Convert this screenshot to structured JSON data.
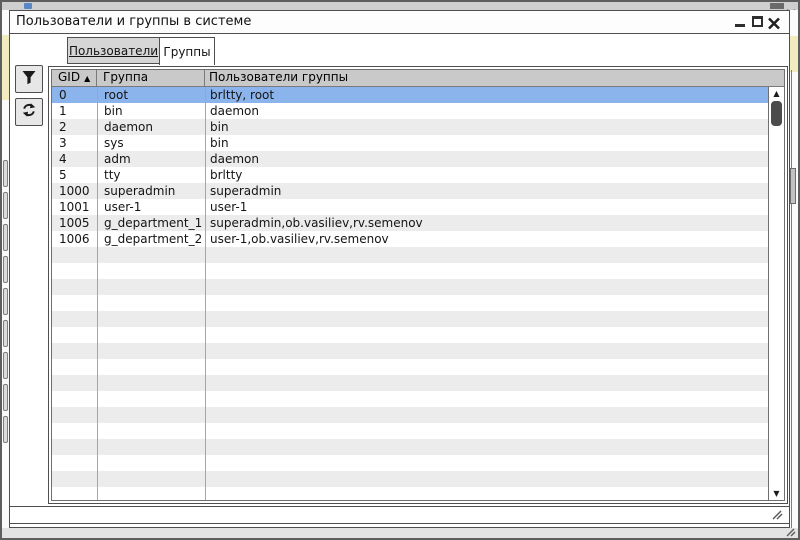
{
  "outer_window": {
    "close_icon": "close-icon"
  },
  "window": {
    "title": "Пользователи и группы в системе",
    "controls": {
      "minimize": "minimize-icon",
      "maximize": "maximize-icon",
      "close": "close-icon"
    }
  },
  "tabs": [
    {
      "label": "Пользователи",
      "active": false
    },
    {
      "label": "Группы",
      "active": true
    }
  ],
  "toolbar": {
    "filter_icon": "filter-funnel-icon",
    "refresh_icon": "refresh-icon"
  },
  "table": {
    "columns": [
      {
        "label": "GID"
      },
      {
        "label": "Группа"
      },
      {
        "label": "Пользователи группы"
      }
    ],
    "sorted_by": "GID",
    "sort_order": "asc",
    "sort_indicator": "▲",
    "rows": [
      {
        "gid": "0",
        "group": "root",
        "users": "brltty, root",
        "selected": true
      },
      {
        "gid": "1",
        "group": "bin",
        "users": "daemon"
      },
      {
        "gid": "2",
        "group": "daemon",
        "users": "bin"
      },
      {
        "gid": "3",
        "group": "sys",
        "users": "bin"
      },
      {
        "gid": "4",
        "group": "adm",
        "users": "daemon"
      },
      {
        "gid": "5",
        "group": "tty",
        "users": "brltty"
      },
      {
        "gid": "1000",
        "group": "superadmin",
        "users": "superadmin"
      },
      {
        "gid": "1001",
        "group": "user-1",
        "users": "user-1"
      },
      {
        "gid": "1005",
        "group": "g_department_1",
        "users": "superadmin,ob.vasiliev,rv.semenov"
      },
      {
        "gid": "1006",
        "group": "g_department_2",
        "users": "user-1,ob.vasiliev,rv.semenov"
      }
    ]
  },
  "scrollbar": {
    "up_icon": "▲",
    "down_icon": "▼"
  },
  "colors": {
    "selection": "#8cb4ec",
    "header_bg": "#c9c9c9",
    "row_alt": "#ececec",
    "background_accent_yellow": "#f0ecc0"
  }
}
